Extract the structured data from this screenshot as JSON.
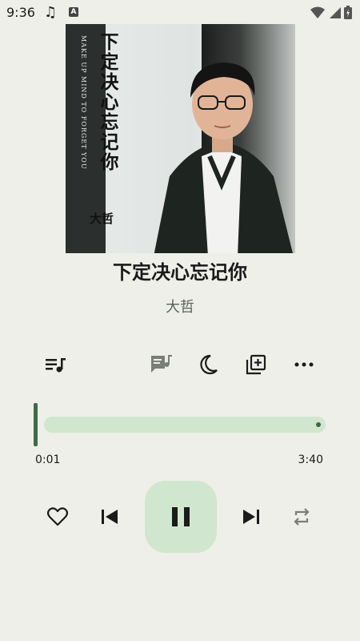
{
  "status_bar": {
    "time": "9:36"
  },
  "album_art": {
    "cover_title": "下定决心忘记你",
    "cover_subtitle": "MAKE UP MIND TO FORGET YOU",
    "cover_artist": "大哲"
  },
  "track": {
    "title": "下定决心忘记你",
    "artist": "大哲",
    "elapsed": "0:01",
    "duration": "3:40",
    "progress": 0.005
  },
  "colors": {
    "background": "#eeefe8",
    "accent": "#3f6b46",
    "accent_container": "#d1e6cf"
  }
}
